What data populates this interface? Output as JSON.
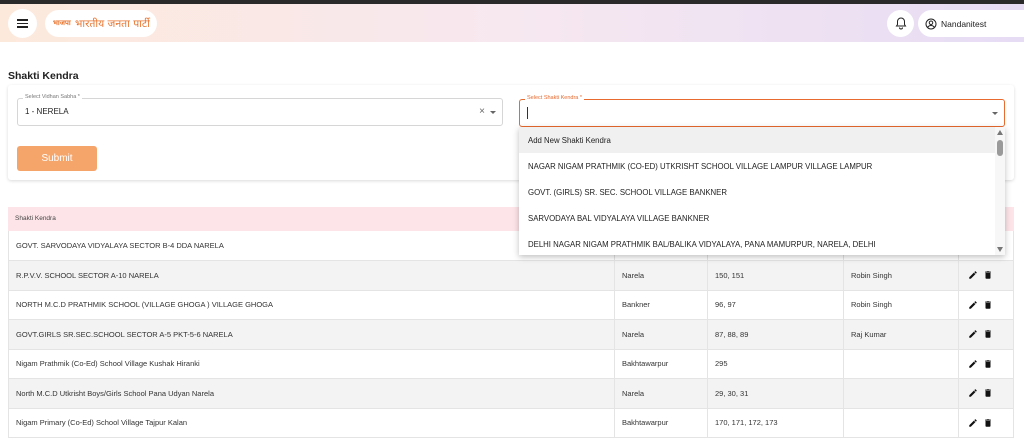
{
  "header": {
    "logo_mark": "भाजपा",
    "logo_text": "भारतीय जनता पार्टी",
    "user_name": "Nandanitest",
    "menu_icon": "hamburger-icon",
    "bell_icon": "bell-icon",
    "user_icon": "user-circle-icon"
  },
  "page": {
    "title": "Shakti Kendra"
  },
  "form": {
    "vidhan_sabha": {
      "label": "Select Vidhan Sabha *",
      "value": "1 - NERELA"
    },
    "shakti_kendra": {
      "label": "Select Shakti Kendra *",
      "value": ""
    },
    "submit_label": "Submit"
  },
  "dropdown": {
    "options": [
      "Add New Shakti Kendra",
      "NAGAR NIGAM PRATHMIK (CO-ED) UTKRISHT SCHOOL VILLAGE LAMPUR VILLAGE LAMPUR",
      "GOVT. (GIRLS) SR. SEC. SCHOOL VILLAGE BANKNER",
      "SARVODAYA BAL VIDYALAYA VILLAGE BANKNER",
      "DELHI NAGAR NIGAM PRATHMIK BAL/BALIKA VIDYALAYA, PANA MAMURPUR, NARELA, DELHI"
    ]
  },
  "table": {
    "header": "Shakti Kendra",
    "rows": [
      {
        "name": "GOVT. SARVODAYA VIDYALAYA SECTOR B-4 DDA NARELA",
        "mandal": "",
        "booths": "",
        "incharge": ""
      },
      {
        "name": "R.P.V.V. SCHOOL SECTOR A-10 NARELA",
        "mandal": "Narela",
        "booths": "150, 151",
        "incharge": "Robin Singh"
      },
      {
        "name": "NORTH M.C.D PRATHMIK SCHOOL (VILLAGE GHOGA ) VILLAGE GHOGA",
        "mandal": "Bankner",
        "booths": "96, 97",
        "incharge": "Robin Singh"
      },
      {
        "name": "GOVT.GIRLS SR.SEC.SCHOOL SECTOR A-5 PKT-5-6 NARELA",
        "mandal": "Narela",
        "booths": "87, 88, 89",
        "incharge": "Raj Kumar"
      },
      {
        "name": "Nigam Prathmik (Co-Ed) School Village Kushak Hiranki",
        "mandal": "Bakhtawarpur",
        "booths": "295",
        "incharge": ""
      },
      {
        "name": "North M.C.D Utkrisht Boys/Girls School Pana Udyan Narela",
        "mandal": "Narela",
        "booths": "29, 30, 31",
        "incharge": ""
      },
      {
        "name": "Nigam Primary (Co-Ed) School Village Tajpur Kalan",
        "mandal": "Bakhtawarpur",
        "booths": "170, 171, 172, 173",
        "incharge": ""
      }
    ]
  },
  "colors": {
    "accent": "#e96a2e",
    "submit": "#f6a56a",
    "table_header": "#fde4e8"
  }
}
